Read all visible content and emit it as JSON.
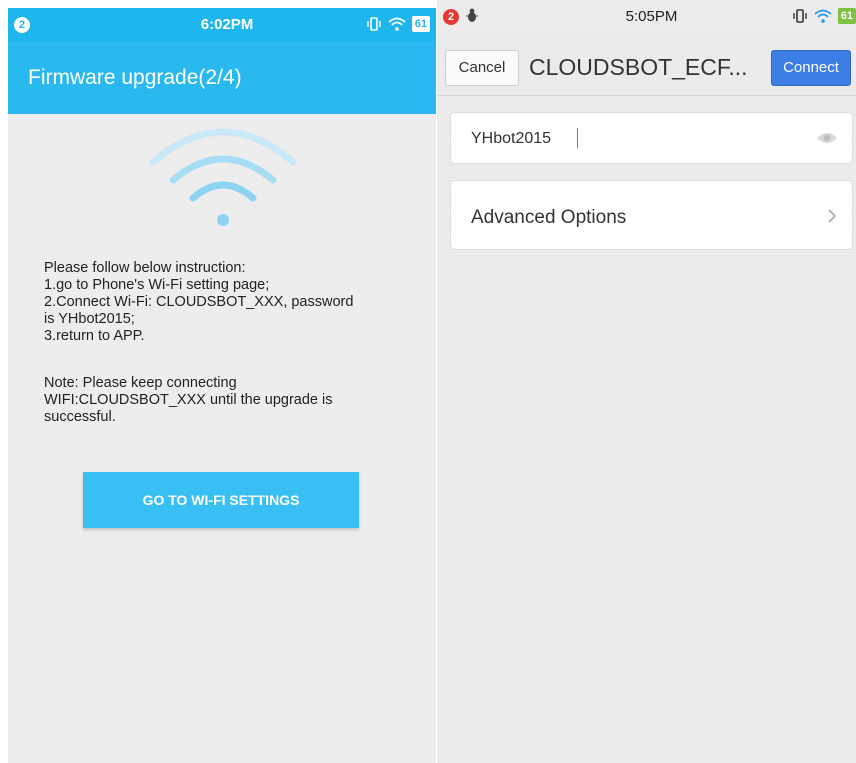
{
  "left": {
    "status": {
      "notification_count": "2",
      "time": "6:02PM",
      "battery": "61"
    },
    "appbar": {
      "title": "Firmware upgrade(2/4)"
    },
    "instructions": {
      "heading": "Please follow below instruction:",
      "step1": "1.go to Phone's Wi-Fi setting page;",
      "step2": "2.Connect Wi-Fi: CLOUDSBOT_XXX, password\nis YHbot2015;",
      "step3": "3.return to APP."
    },
    "note": "Note: Please keep connecting\nWIFI:CLOUDSBOT_XXX until the upgrade is\nsuccessful.",
    "button_label": "GO TO WI-FI SETTINGS",
    "colors": {
      "accent": "#2ab9ef",
      "button": "#39bff3",
      "background": "#ededed"
    }
  },
  "right": {
    "status": {
      "notification_count": "2",
      "time": "5:05PM",
      "battery": "61"
    },
    "nav": {
      "cancel_label": "Cancel",
      "network_name": "CLOUDSBOT_ECF...",
      "connect_label": "Connect"
    },
    "password": {
      "value": "YHbot2015"
    },
    "advanced_label": "Advanced Options",
    "colors": {
      "connect": "#3d7ee4",
      "background": "#ececec"
    }
  }
}
